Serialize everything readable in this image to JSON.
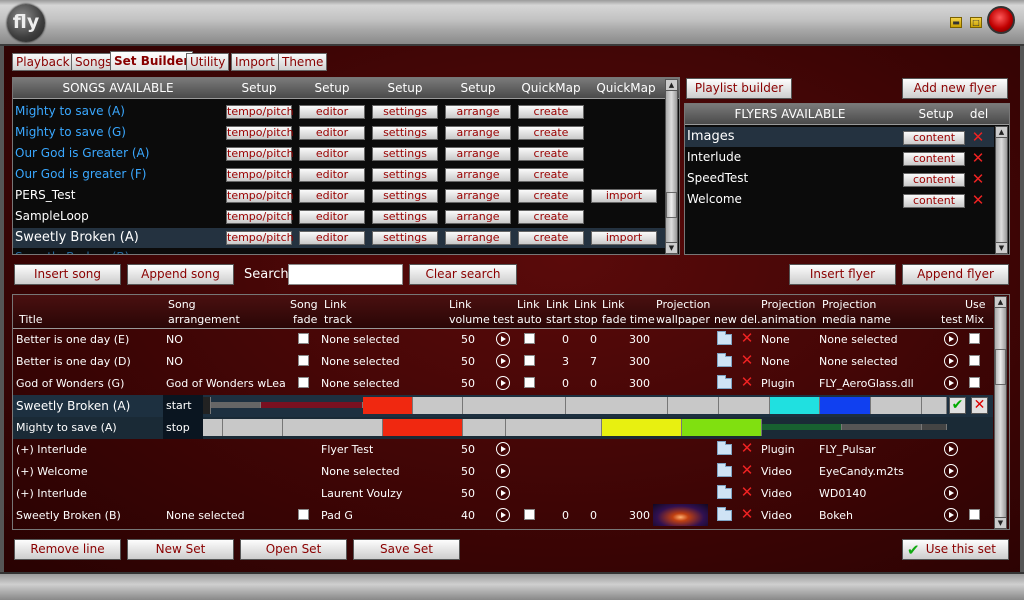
{
  "app": {
    "logo": "fly"
  },
  "tabs": [
    {
      "label": "Playback"
    },
    {
      "label": "Songs"
    },
    {
      "label": "Set Builder"
    },
    {
      "label": "Utility"
    },
    {
      "label": "Import"
    },
    {
      "label": "Theme"
    }
  ],
  "songs_panel": {
    "headers": [
      "SONGS AVAILABLE",
      "Setup",
      "Setup",
      "Setup",
      "Setup",
      "QuickMap",
      "QuickMap"
    ],
    "buttons": {
      "tempo": "tempo/pitch",
      "editor": "editor",
      "settings": "settings",
      "arrange": "arrange",
      "create": "create",
      "import": "import"
    },
    "songs": [
      {
        "name": "Mighty to save (A)"
      },
      {
        "name": "Mighty to save (G)"
      },
      {
        "name": "Our God is Greater (A)"
      },
      {
        "name": "Our God is greater (F)"
      },
      {
        "name": "PERS_Test"
      },
      {
        "name": "SampleLoop"
      },
      {
        "name": "Sweetly Broken (A)"
      }
    ]
  },
  "flyers_panel": {
    "playlist_builder": "Playlist builder",
    "add_new_flyer": "Add new flyer",
    "headers": [
      "FLYERS AVAILABLE",
      "Setup",
      "del"
    ],
    "content_label": "content",
    "flyers": [
      {
        "name": "Images"
      },
      {
        "name": "Interlude"
      },
      {
        "name": "SpeedTest"
      },
      {
        "name": "Welcome"
      }
    ]
  },
  "mid_buttons": {
    "insert_song": "Insert song",
    "append_song": "Append song",
    "search_label": "Search",
    "search_value": "",
    "clear_search": "Clear search",
    "insert_flyer": "Insert flyer",
    "append_flyer": "Append flyer"
  },
  "set_grid": {
    "headers": {
      "title": "Title",
      "song_arr_1": "Song",
      "song_arr_2": "arrangement",
      "song_fade_1": "Song",
      "song_fade_2": "fade",
      "link_track_1": "Link",
      "link_track_2": "track",
      "link_vol_1": "Link",
      "link_vol_2": "volume",
      "test": "test",
      "link_auto_1": "Link",
      "link_auto_2": "auto",
      "link_start_1": "Link",
      "link_start_2": "start",
      "link_stop_1": "Link",
      "link_stop_2": "stop",
      "link_fade_1": "Link",
      "link_fade_2": "fade time",
      "proj_wall_1": "Projection",
      "proj_wall_2": "wallpaper",
      "new_del": "new del.",
      "proj_anim_1": "Projection",
      "proj_anim_2": "animation",
      "proj_media_1": "Projection",
      "proj_media_2": "media name",
      "test2": "test",
      "use_mix_1": "Use",
      "use_mix_2": "Mix"
    },
    "rows": [
      {
        "title": "Better is one day (E)",
        "arrangement": "NO",
        "track": "None selected",
        "volume": "50",
        "start": "0",
        "stop": "0",
        "fade": "300",
        "animation": "None",
        "media": "None selected"
      },
      {
        "title": "Better is one day (D)",
        "arrangement": "NO",
        "track": "None selected",
        "volume": "50",
        "start": "3",
        "stop": "7",
        "fade": "300",
        "animation": "None",
        "media": "None selected"
      },
      {
        "title": "God of Wonders (G)",
        "arrangement": "God of Wonders wLead",
        "track": "None selected",
        "volume": "50",
        "start": "0",
        "stop": "0",
        "fade": "300",
        "animation": "Plugin",
        "media": "FLY_AeroGlass.dll"
      }
    ],
    "transition": {
      "from_title": "Sweetly Broken (A)",
      "from_label": "start",
      "to_title": "Mighty to save (A)",
      "to_label": "stop"
    },
    "flyer_rows": [
      {
        "title": "(+) Interlude",
        "track": "Flyer Test",
        "volume": "50",
        "animation": "Plugin",
        "media": "FLY_Pulsar"
      },
      {
        "title": "(+) Welcome",
        "track": "None selected",
        "volume": "50",
        "animation": "Video",
        "media": "EyeCandy.m2ts"
      },
      {
        "title": "(+) Interlude",
        "track": "Laurent Voulzy",
        "volume": "50",
        "animation": "Video",
        "media": "WD0140"
      }
    ],
    "last_row": {
      "title": "Sweetly Broken (B)",
      "arrangement": "None selected",
      "track": "Pad G",
      "volume": "40",
      "start": "0",
      "stop": "0",
      "fade": "300",
      "animation": "Video",
      "media": "Bokeh"
    }
  },
  "bottom_buttons": {
    "remove_line": "Remove line",
    "new_set": "New Set",
    "open_set": "Open Set",
    "save_set": "Save Set",
    "use_set": "Use this set"
  },
  "colors": {
    "accent": "#8a0000",
    "link_blue": "#3aa8ff",
    "selected_row": "#243240"
  }
}
